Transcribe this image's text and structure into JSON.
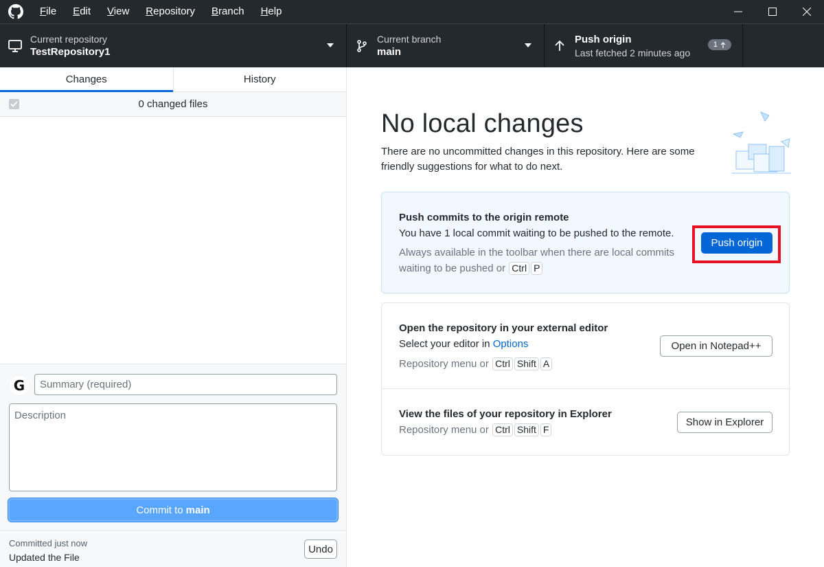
{
  "titlebar": {
    "menu": [
      "File",
      "Edit",
      "View",
      "Repository",
      "Branch",
      "Help"
    ]
  },
  "toolbar": {
    "repo_label": "Current repository",
    "repo_name": "TestRepository1",
    "branch_label": "Current branch",
    "branch_name": "main",
    "push_title": "Push origin",
    "push_subtitle": "Last fetched 2 minutes ago",
    "push_badge": "1"
  },
  "sidebar": {
    "tabs": [
      "Changes",
      "History"
    ],
    "changed_files": "0 changed files",
    "avatar_letter": "G",
    "summary_placeholder": "Summary (required)",
    "description_placeholder": "Description",
    "commit_prefix": "Commit to",
    "commit_branch": "main",
    "last_commit_when": "Committed just now",
    "last_commit_msg": "Updated the File",
    "undo_label": "Undo"
  },
  "main": {
    "headline": "No local changes",
    "subtext": "There are no uncommitted changes in this repository. Here are some friendly suggestions for what to do next.",
    "push_card": {
      "title": "Push commits to the origin remote",
      "desc": "You have 1 local commit waiting to be pushed to the remote.",
      "hint_line1": "Always available in the toolbar when there are local commits",
      "hint_line2_prefix": "waiting to be pushed or",
      "keys": [
        "Ctrl",
        "P"
      ],
      "button": "Push origin"
    },
    "editor_card": {
      "title": "Open the repository in your external editor",
      "desc_prefix": "Select your editor in",
      "desc_link": "Options",
      "hint_prefix": "Repository menu or",
      "keys": [
        "Ctrl",
        "Shift",
        "A"
      ],
      "button": "Open in Notepad++"
    },
    "explorer_card": {
      "title": "View the files of your repository in Explorer",
      "hint_prefix": "Repository menu or",
      "keys": [
        "Ctrl",
        "Shift",
        "F"
      ],
      "button": "Show in Explorer"
    }
  },
  "colors": {
    "chrome": "#24292e",
    "accent": "#0366d6",
    "commit_button": "#58a6ff",
    "highlight": "#e81123"
  }
}
